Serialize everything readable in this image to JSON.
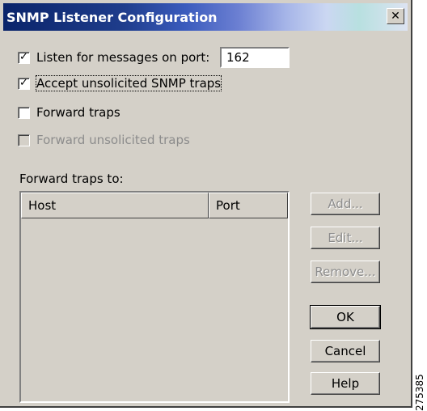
{
  "window": {
    "title": "SNMP Listener Configuration",
    "close_glyph": "✕"
  },
  "options": {
    "listen": {
      "label": "Listen for messages on port:",
      "checked": true
    },
    "port_value": "162",
    "accept_unsolicited": {
      "label": "Accept unsolicited SNMP traps",
      "checked": true
    },
    "forward_traps": {
      "label": "Forward traps",
      "checked": false
    },
    "forward_unsolicited": {
      "label": "Forward unsolicited traps",
      "checked": false,
      "disabled": true
    }
  },
  "forward_to": {
    "label": "Forward traps to:",
    "columns": [
      "Host",
      "Port"
    ],
    "rows": []
  },
  "buttons": {
    "add": "Add...",
    "edit": "Edit...",
    "remove": "Remove...",
    "ok": "OK",
    "cancel": "Cancel",
    "help": "Help"
  },
  "figure_code": "275385",
  "colors": {
    "face": "#d4d0c8",
    "title_start": "#0a246a",
    "disabled_text": "#8c8c8c"
  }
}
